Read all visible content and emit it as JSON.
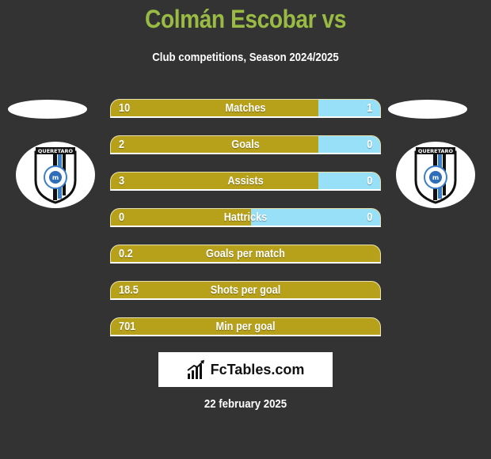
{
  "header": {
    "title": "Colmán Escobar vs",
    "subtitle": "Club competitions, Season 2024/2025"
  },
  "teams": {
    "left": {
      "logo_icon": "queretaro-crest-icon",
      "logo_text": "QUERETARO"
    },
    "right": {
      "logo_icon": "queretaro-crest-icon",
      "logo_text": "QUERETARO"
    }
  },
  "colors": {
    "background": "#333333",
    "title": "#99bb44",
    "left_bar": "#b8a11a",
    "right_bar": "#97e0f7"
  },
  "stats": [
    {
      "label": "Matches",
      "left": "10",
      "right": "1",
      "left_share": 0.77
    },
    {
      "label": "Goals",
      "left": "2",
      "right": "0",
      "left_share": 0.77
    },
    {
      "label": "Assists",
      "left": "3",
      "right": "0",
      "left_share": 0.77
    },
    {
      "label": "Hattricks",
      "left": "0",
      "right": "0",
      "left_share": 0.52
    },
    {
      "label": "Goals per match",
      "left": "0.2",
      "right": null,
      "left_share": 1.0
    },
    {
      "label": "Shots per goal",
      "left": "18.5",
      "right": null,
      "left_share": 1.0
    },
    {
      "label": "Min per goal",
      "left": "701",
      "right": null,
      "left_share": 1.0
    }
  ],
  "brand": {
    "icon": "bar-chart-icon",
    "text": "FcTables.com"
  },
  "footer": {
    "date": "22 february 2025"
  }
}
